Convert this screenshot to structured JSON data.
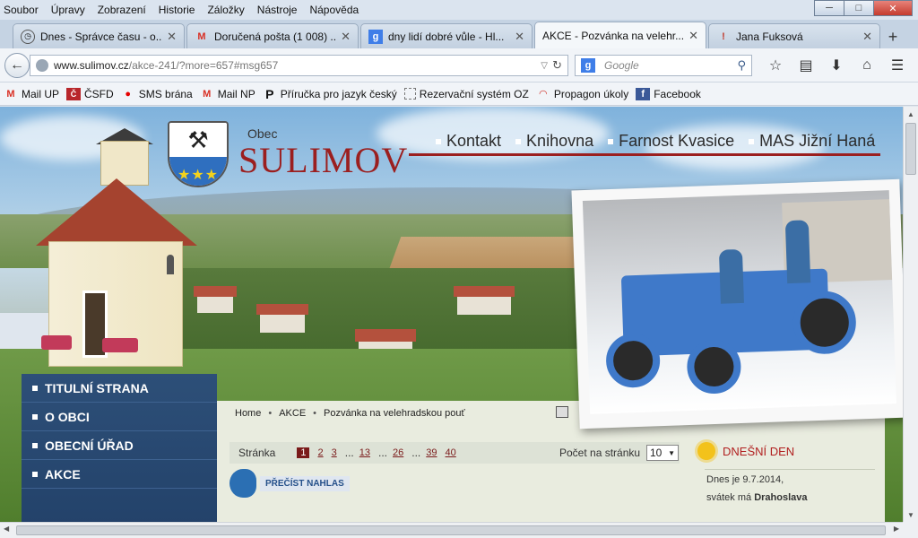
{
  "menu": [
    "Soubor",
    "Úpravy",
    "Zobrazení",
    "Historie",
    "Záložky",
    "Nástroje",
    "Nápověda"
  ],
  "window_controls": {
    "minimize": "─",
    "maximize": "□",
    "close": "✕"
  },
  "tabs": [
    {
      "icon": "clock",
      "label": "Dnes - Správce času - o..."
    },
    {
      "icon": "M",
      "label": "Doručená pošta (1 008) ..."
    },
    {
      "icon": "g",
      "label": "dny lidí dobré vůle - Hl..."
    },
    {
      "icon": "",
      "label": "AKCE - Pozvánka na velehr...",
      "active": true
    },
    {
      "icon": "!",
      "label": "Jana Fuksová"
    }
  ],
  "url": {
    "host": "www.sulimov.cz",
    "path": "/akce-241/?more=657#msg657"
  },
  "search": {
    "placeholder": "Google",
    "engine": "g"
  },
  "bookmarks": [
    {
      "icon": "M",
      "label": "Mail UP"
    },
    {
      "icon": "Č",
      "label": "ČSFD"
    },
    {
      "icon": "●",
      "label": "SMS brána"
    },
    {
      "icon": "M",
      "label": "Mail NP"
    },
    {
      "icon": "P",
      "label": "Příručka pro jazyk český"
    },
    {
      "icon": "",
      "label": "Rezervační systém OZ"
    },
    {
      "icon": "◠",
      "label": "Propagon úkoly"
    },
    {
      "icon": "f",
      "label": "Facebook"
    }
  ],
  "site": {
    "obec": "Obec",
    "name": "SULIMOV",
    "topnav": [
      "Kontakt",
      "Knihovna",
      "Farnost Kvasice",
      "MAS Jižní Haná"
    ]
  },
  "sidebar": [
    "TITULNÍ STRANA",
    "O OBCI",
    "OBECNÍ ÚŘAD",
    "AKCE"
  ],
  "breadcrumb": [
    "Home",
    "AKCE",
    "Pozvánka na velehradskou pouť"
  ],
  "pager": {
    "label": "Stránka",
    "pages": [
      "1",
      "2",
      "3",
      "...",
      "13",
      "...",
      "26",
      "...",
      "39",
      "40"
    ],
    "current": "1",
    "per_page_label": "Počet na stránku",
    "per_page_value": "10"
  },
  "read_aloud": "PŘEČÍST NAHLAS",
  "today": {
    "title": "DNEŠNÍ DEN",
    "date_line": "Dnes je 9.7.2014,",
    "nameday_prefix": "svátek má",
    "nameday_name": "Drahoslava"
  },
  "colors": {
    "accent": "#9b1f1f",
    "sidebar": "#2d4f78",
    "content_bg": "#e9ecdf"
  }
}
